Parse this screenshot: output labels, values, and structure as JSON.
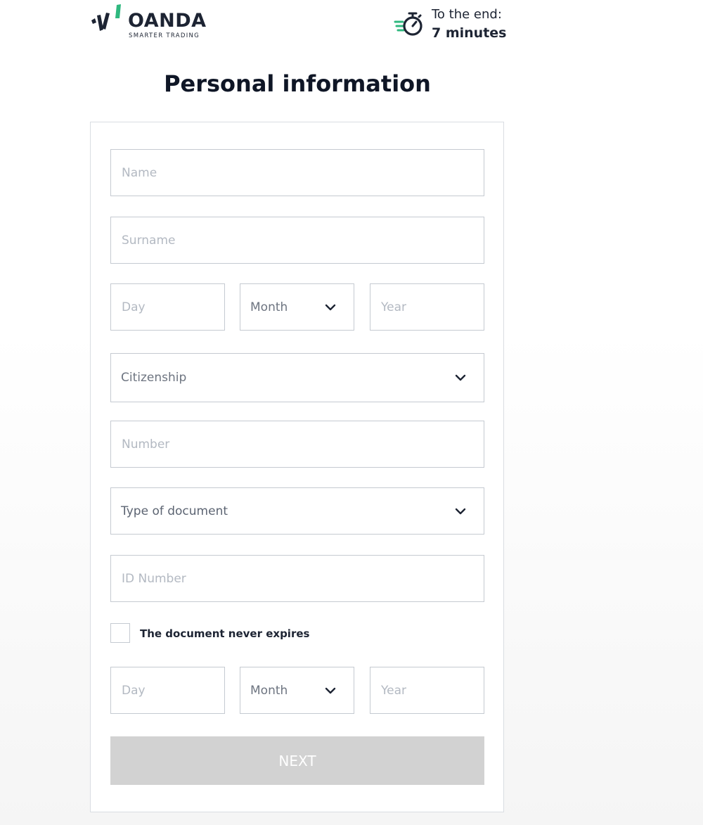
{
  "header": {
    "brand": "OANDA",
    "tagline": "SMARTER TRADING",
    "timer_label": "To the end:",
    "timer_value": "7 minutes",
    "timer_icon": "stopwatch-icon",
    "accent_color": "#2fb87f"
  },
  "page_title": "Personal information",
  "form": {
    "name_placeholder": "Name",
    "surname_placeholder": "Surname",
    "birth": {
      "day_placeholder": "Day",
      "month_label": "Month",
      "year_placeholder": "Year"
    },
    "citizenship_label": "Citizenship",
    "number_placeholder": "Number",
    "document_type_label": "Type of document",
    "id_number_placeholder": "ID Number",
    "never_expires_label": "The document never expires",
    "expiry": {
      "day_placeholder": "Day",
      "month_label": "Month",
      "year_placeholder": "Year"
    },
    "next_label": "NEXT"
  }
}
